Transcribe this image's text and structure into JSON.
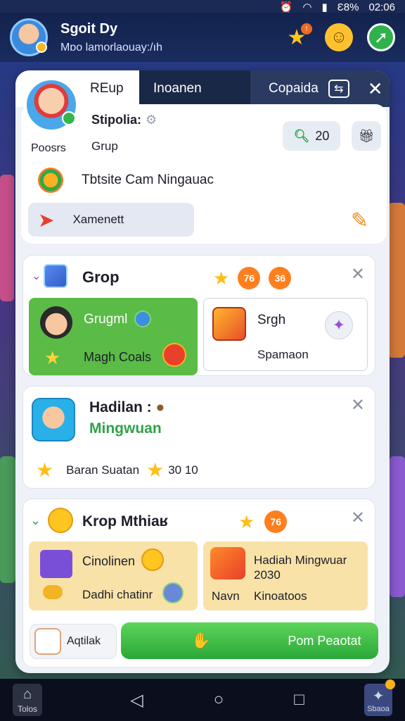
{
  "status_bar": {
    "battery": "Ɛ8%",
    "time": "02:06"
  },
  "header": {
    "name": "Sgoit Dy",
    "subtitle": "Mɒo lamorlaouay:/ıh"
  },
  "tabs": [
    {
      "label": "REup"
    },
    {
      "label": "Inoanen"
    },
    {
      "label": "Copaida"
    }
  ],
  "profile": {
    "label": "Poosrs",
    "name": "Stipolia:",
    "group": "Grup",
    "count": "20",
    "game_title": "Tbtsite Cam Ningauac",
    "field_value": "Xamenett"
  },
  "section_1": {
    "title": "Grop",
    "badge_1": "76",
    "badge_2": "36",
    "tile_left_title": "Grugml",
    "tile_left_sub": "Magh Coals",
    "tile_right_title": "Srgh",
    "tile_right_sub": "Spamaon"
  },
  "section_2": {
    "title": "Hadilan :",
    "subtitle": "Mingwuan",
    "row_label": "Baran Suatan",
    "row_value": "30 10"
  },
  "section_3": {
    "title": "Krop Mthiaʁ",
    "badge": "76",
    "tile_left_title": "Cinolinen",
    "tile_left_sub": "Dadhi chatinr",
    "tile_right_title": "Hadiah Mingwuar 2030",
    "tile_right_label_1": "Navn",
    "tile_right_label_2": "Kinoatoos"
  },
  "bottom": {
    "bag_label": "Aqtilak",
    "main_button": "Pom Peaotat"
  },
  "navbar": {
    "home_label": "Tolos",
    "shop_label": "Sbaoa"
  },
  "colors": {
    "accent_green": "#3db544",
    "topbar": "#16274f",
    "panel_bg": "#eef1f7",
    "orange_badge": "#ff7f1f"
  }
}
